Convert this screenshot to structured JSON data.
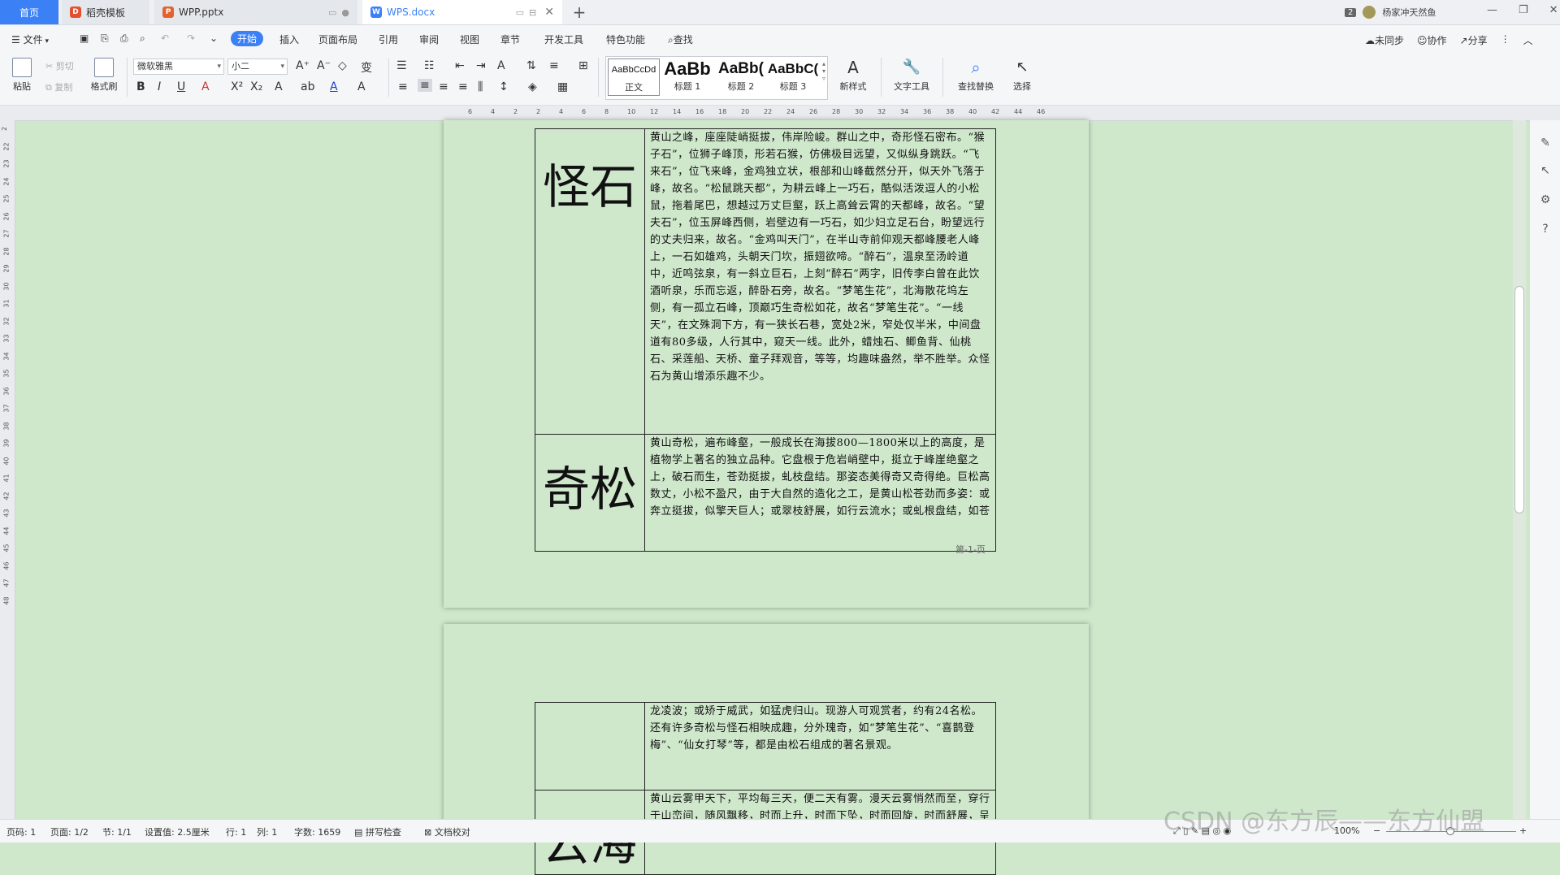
{
  "tabs": {
    "home": "首页",
    "t1": "稻壳模板",
    "t2": "WPP.pptx",
    "t3": "WPS.docx"
  },
  "user": {
    "badge": "2",
    "name": "杨家冲天然鱼"
  },
  "menu": {
    "file": "文件",
    "items": [
      "开始",
      "插入",
      "页面布局",
      "引用",
      "审阅",
      "视图",
      "章节",
      "开发工具",
      "特色功能"
    ],
    "search": "查找",
    "right": [
      "未同步",
      "协作",
      "分享"
    ]
  },
  "ribbon": {
    "paste": "粘贴",
    "cut": "剪切",
    "copy": "复制",
    "format_painter": "格式刷",
    "font_name": "微软雅黑",
    "font_size": "小二",
    "styles": [
      {
        "preview": "AaBbCcDd",
        "label": "正文"
      },
      {
        "preview": "AaBb",
        "label": "标题 1"
      },
      {
        "preview": "AaBb(",
        "label": "标题 2"
      },
      {
        "preview": "AaBbC(",
        "label": "标题 3"
      }
    ],
    "new_style": "新样式",
    "text_tools": "文字工具",
    "find_replace": "查找替换",
    "select": "选择"
  },
  "ruler": {
    "numbers": [
      "6",
      "4",
      "2",
      "2",
      "4",
      "6",
      "8",
      "10",
      "12",
      "14",
      "16",
      "18",
      "20",
      "22",
      "24",
      "26",
      "28",
      "30",
      "32",
      "34",
      "36",
      "38",
      "40",
      "42",
      "44",
      "46"
    ]
  },
  "vruler": {
    "numbers": [
      "2",
      "22",
      "23",
      "24",
      "25",
      "26",
      "27",
      "28",
      "29",
      "30",
      "31",
      "32",
      "33",
      "34",
      "35",
      "36",
      "37",
      "38",
      "39",
      "40",
      "41",
      "42",
      "43",
      "44",
      "45",
      "46",
      "47",
      "48"
    ]
  },
  "doc": {
    "rows": [
      {
        "title": "怪石",
        "text": "黄山之峰，座座陡峭挺拔，伟岸险峻。群山之中，奇形怪石密布。“猴子石”，位狮子峰顶，形若石猴，仿佛极目远望，又似纵身跳跃。“飞来石”，位飞来峰，金鸡独立状，根部和山峰截然分开，似天外飞落于峰，故名。“松鼠跳天都”，为耕云峰上一巧石，酷似活泼逗人的小松鼠，拖着尾巴，想越过万丈巨壑，跃上高耸云霄的天都峰，故名。“望夫石”，位玉屏峰西侧，岩壁边有一巧石，如少妇立足石台，盼望远行的丈夫归来，故名。“金鸡叫天门”，在半山寺前仰观天都峰腰老人峰上，一石如雄鸡，头朝天门坎，振翅欲啼。“醉石”，温泉至汤岭道中，近鸣弦泉，有一斜立巨石，上刻“醉石”两字，旧传李白曾在此饮酒听泉，乐而忘返，醉卧石旁，故名。“梦笔生花”，北海散花坞左侧，有一孤立石峰，顶巅巧生奇松如花，故名“梦笔生花”。“一线天”，在文殊洞下方，有一狭长石巷，宽处2米，窄处仅半米，中间盘道有80多级，人行其中，窥天一线。此外，蜡烛石、鲫鱼背、仙桃石、采莲船、天桥、童子拜观音，等等，均趣味盎然，举不胜举。众怪石为黄山增添乐趣不少。"
      },
      {
        "title": "奇松",
        "text": "黄山奇松，遍布峰壑，一般成长在海拔800—1800米以上的高度，是植物学上著名的独立品种。它盘根于危岩峭壁中，挺立于峰崖绝壑之上，破石而生，苍劲挺拔，虬枝盘结。那姿态美得奇又奇得绝。巨松高数丈，小松不盈尺，由于大自然的造化之工，是黄山松苍劲而多姿：或奔立挺拔，似擎天巨人；或翠枝舒展，如行云流水；或虬根盘结，如苍"
      }
    ],
    "page_footer": "第-1-页",
    "page2_rows": [
      {
        "title": "",
        "text": "龙凌波；或矫于威武，如猛虎归山。现游人可观赏者，约有24名松。还有许多奇松与怪石相映成趣，分外瑰奇，如“梦笔生花”、“喜鹊登梅”、“仙女打琴”等，都是由松石组成的著名景观。"
      },
      {
        "title": "云海",
        "text": "黄山云雾甲天下，平均每三天，便二天有雾。漫天云雾悄然而至，穿行于山峦间，随风飘移，时而上升，时而下坠，时而回旋，时而舒展，呈现云海奇观。云海，好在似海非海，"
      }
    ]
  },
  "status": {
    "page_code": "页码: 1",
    "page": "页面: 1/2",
    "section": "节: 1/1",
    "setting": "设置值: 2.5厘米",
    "row": "行: 1",
    "col": "列: 1",
    "words": "字数: 1659",
    "spell": "拼写检查",
    "proof": "文档校对",
    "zoom": "100%"
  },
  "watermark": "CSDN @东方辰——东方仙盟"
}
